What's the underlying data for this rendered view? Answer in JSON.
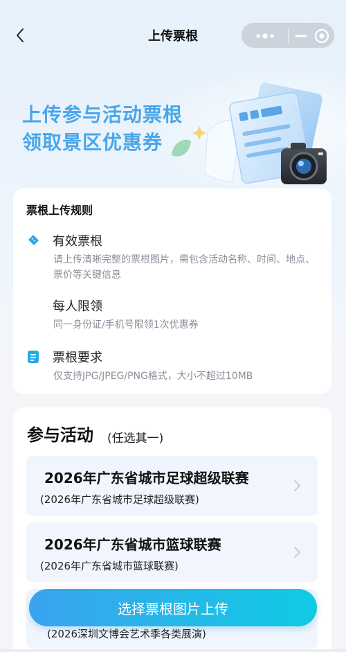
{
  "nav": {
    "title": "上传票根"
  },
  "hero": {
    "line1": "上传参与活动票根",
    "line2": "领取景区优惠券"
  },
  "rules": {
    "title": "票根上传规则",
    "items": [
      {
        "icon": "ticket-icon",
        "title": "有效票根",
        "desc": "请上传清晰完整的票根图片，需包含活动名称、时间、地点、票价等关键信息"
      },
      {
        "icon": "",
        "title": "每人限领",
        "desc": "同一身份证/手机号限领1次优惠券"
      },
      {
        "icon": "document-icon",
        "title": "票根要求",
        "desc": "仅支持JPG/JPEG/PNG格式，大小不超过10MB"
      }
    ]
  },
  "activities": {
    "heading": "参与活动",
    "subheading": "(任选其一)",
    "items": [
      {
        "name": "2026年广东省城市足球超级联赛",
        "tag": "(2026年广东省城市足球超级联赛)"
      },
      {
        "name": "2026年广东省城市篮球联赛",
        "tag": "(2026年广东省城市篮球联赛)"
      },
      {
        "name": "",
        "tag": "(2026深圳文博会艺术季各类展演)"
      }
    ]
  },
  "upload_button": {
    "label": "选择票根图片上传"
  },
  "colors": {
    "accent": "#4aa6e8",
    "button_start": "#3ba3ef",
    "button_end": "#10cbe3",
    "card_bg": "#f1f5fd"
  }
}
